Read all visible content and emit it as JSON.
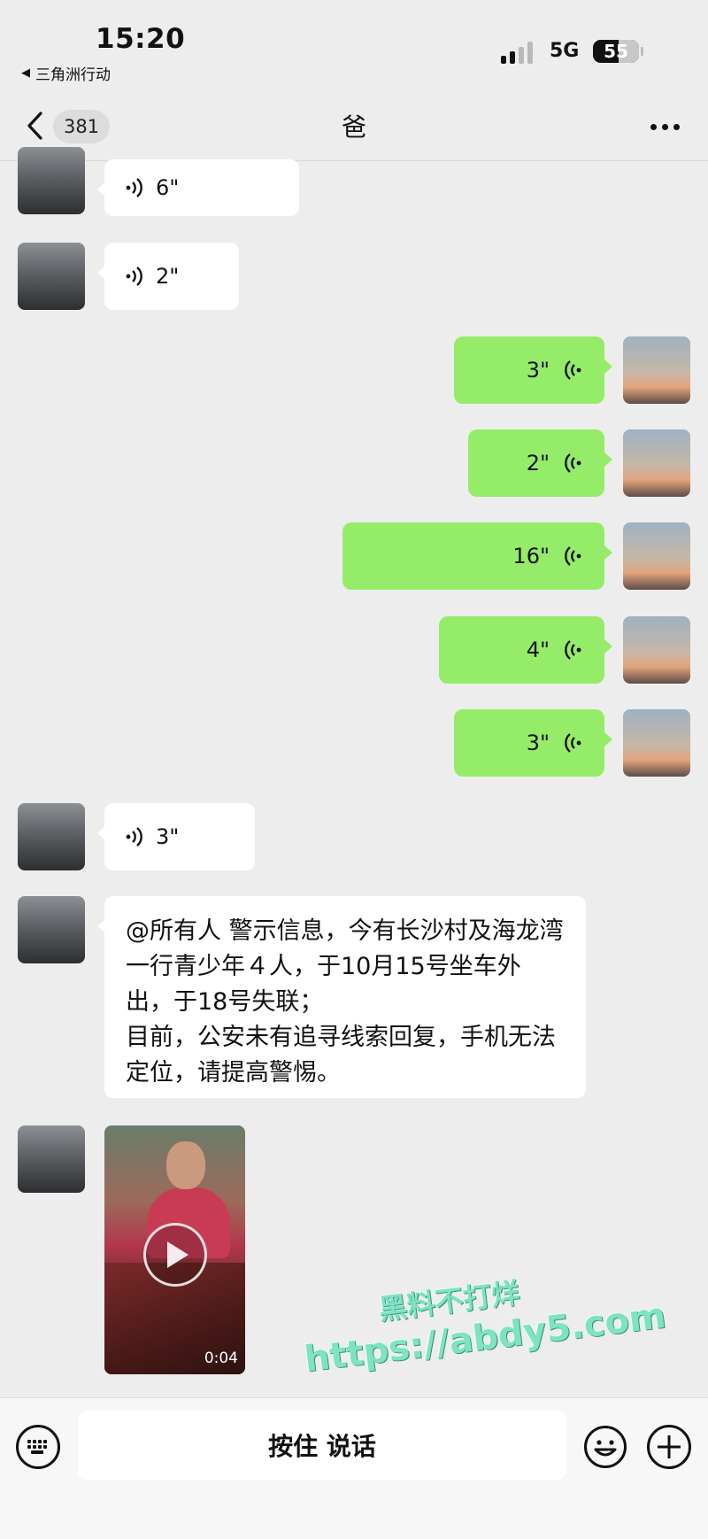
{
  "status_bar": {
    "time": "15:20",
    "back_app": "三角洲行动",
    "network": "5G",
    "battery": "55"
  },
  "nav": {
    "unread_count": "381",
    "title": "爸"
  },
  "messages": [
    {
      "from": "dad",
      "type": "voice",
      "duration": "6\""
    },
    {
      "from": "dad",
      "type": "voice",
      "duration": "2\""
    },
    {
      "from": "me",
      "type": "voice",
      "duration": "3\""
    },
    {
      "from": "me",
      "type": "voice",
      "duration": "2\""
    },
    {
      "from": "me",
      "type": "voice",
      "duration": "16\""
    },
    {
      "from": "me",
      "type": "voice",
      "duration": "4\""
    },
    {
      "from": "me",
      "type": "voice",
      "duration": "3\""
    },
    {
      "from": "dad",
      "type": "voice",
      "duration": "3\""
    },
    {
      "from": "dad",
      "type": "text",
      "text": "@所有人 警示信息，今有长沙村及海龙湾一行青少年４人，于10月15号坐车外出，于18号失联；\n目前，公安未有追寻线索回复，手机无法定位，请提高警惕。"
    },
    {
      "from": "dad",
      "type": "video",
      "duration": "0:04"
    }
  ],
  "watermark": {
    "line1": "黑料不打烊",
    "line2": "https://abdy5.com"
  },
  "input_bar": {
    "hold_to_talk": "按住 说话"
  },
  "colors": {
    "background": "#ededed",
    "bubble_out": "#95ec69",
    "bubble_in": "#ffffff"
  }
}
